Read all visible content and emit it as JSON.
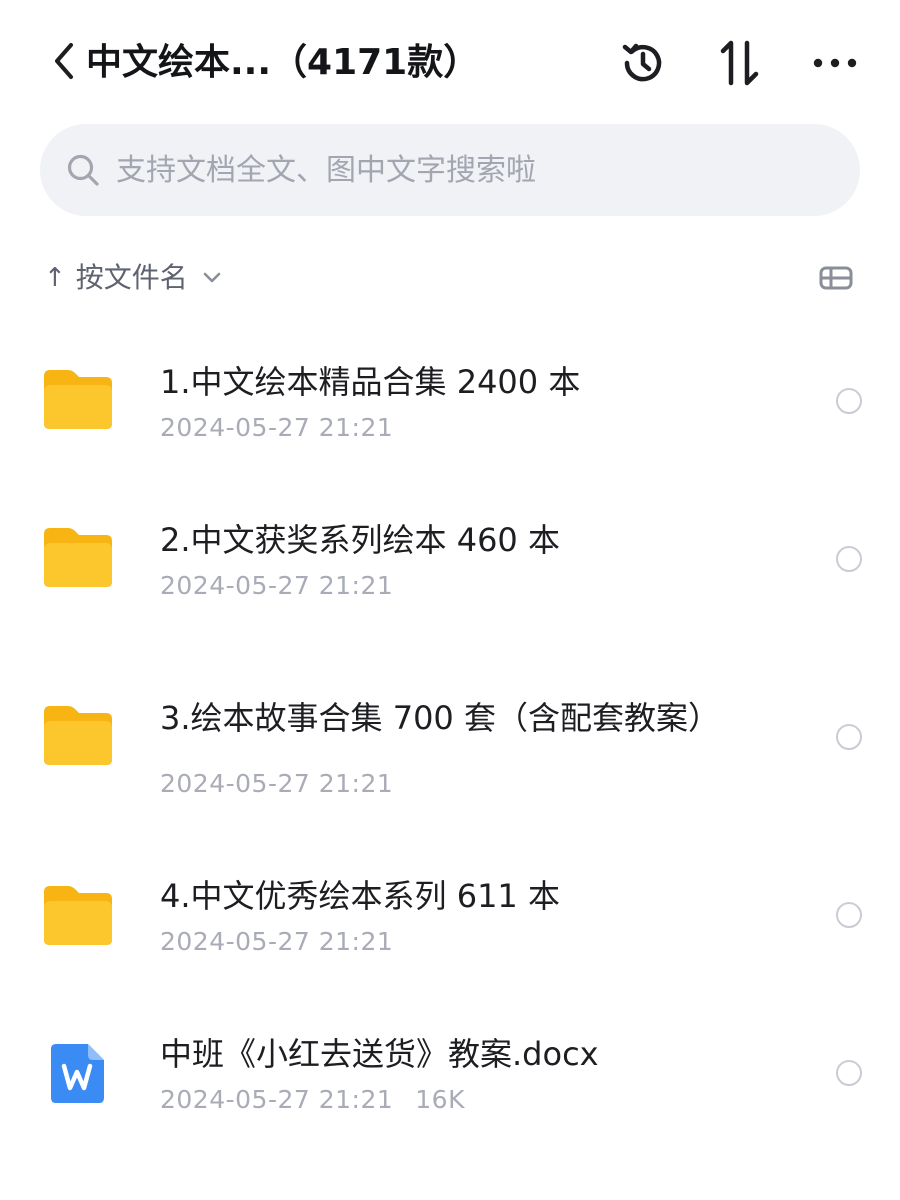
{
  "header": {
    "title": "中文绘本...（4171款）",
    "back_icon": "chevron-left-icon",
    "actions": [
      "history-icon",
      "sort-icon",
      "more-icon"
    ]
  },
  "search": {
    "placeholder": "支持文档全文、图中文字搜索啦",
    "value": ""
  },
  "sort": {
    "arrow": "↑",
    "label": "按文件名",
    "view_icon": "list-view-icon"
  },
  "files": [
    {
      "name": "1.中文绘本精品合集 2400 本",
      "date": "2024-05-27 21:21",
      "size": "",
      "type": "folder"
    },
    {
      "name": "2.中文获奖系列绘本 460 本",
      "date": "2024-05-27 21:21",
      "size": "",
      "type": "folder"
    },
    {
      "name": "3.绘本故事合集 700 套（含配套教案）",
      "date": "2024-05-27 21:21",
      "size": "",
      "type": "folder"
    },
    {
      "name": "4.中文优秀绘本系列 611 本",
      "date": "2024-05-27 21:21",
      "size": "",
      "type": "folder"
    },
    {
      "name": "中班《小红去送货》教案.docx",
      "date": "2024-05-27 21:21",
      "size": "16K",
      "type": "word-doc"
    }
  ],
  "colors": {
    "folder": "#fcc72d",
    "word": "#3a8bf4",
    "search_bg": "#f1f2f6",
    "meta_text": "#a9acb6"
  }
}
